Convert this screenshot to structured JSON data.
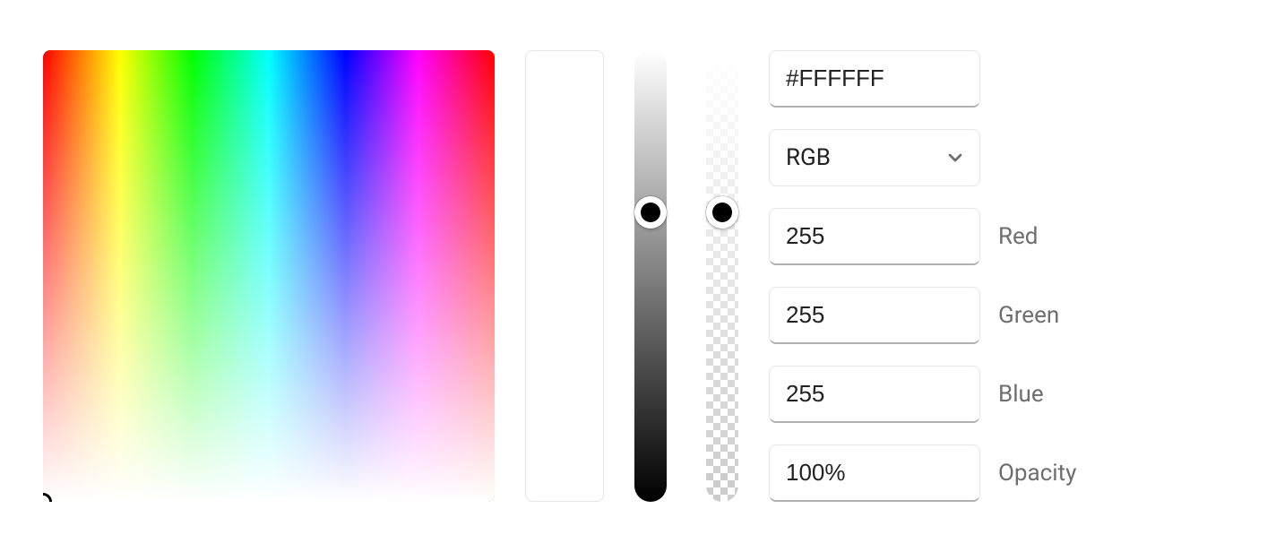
{
  "hex": {
    "value": "#FFFFFF"
  },
  "colorModel": {
    "selected": "RGB"
  },
  "channels": {
    "red": {
      "value": "255",
      "label": "Red"
    },
    "green": {
      "value": "255",
      "label": "Green"
    },
    "blue": {
      "value": "255",
      "label": "Blue"
    }
  },
  "opacity": {
    "value": "100%",
    "label": "Opacity"
  },
  "sliders": {
    "lightness": {
      "handlePercent": 36
    },
    "alpha": {
      "handlePercent": 36
    }
  }
}
